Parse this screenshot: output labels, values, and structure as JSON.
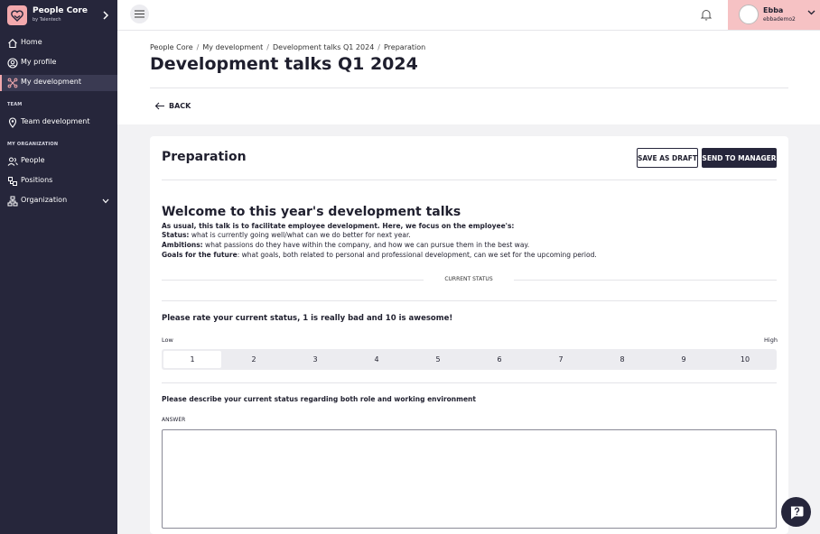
{
  "brand": {
    "title": "People Core",
    "subtitle": "by Talentech"
  },
  "sidebar": {
    "items": [
      {
        "label": "Home",
        "icon": "home-icon"
      },
      {
        "label": "My profile",
        "icon": "user-circle-icon"
      },
      {
        "label": "My development",
        "icon": "development-icon",
        "active": true
      },
      {
        "label": "Team development",
        "icon": "location-pin-icon"
      },
      {
        "label": "People",
        "icon": "people-icon"
      },
      {
        "label": "Positions",
        "icon": "positions-icon"
      },
      {
        "label": "Organization",
        "icon": "organization-icon"
      }
    ],
    "sections": [
      "TEAM",
      "MY ORGANIZATION"
    ]
  },
  "topbar": {
    "user_name": "Ebba",
    "user_handle": "ebbademo2"
  },
  "breadcrumb": [
    "People Core",
    "My development",
    "Development talks Q1 2024",
    "Preparation"
  ],
  "page_title": "Development talks Q1 2024",
  "back_label": "BACK",
  "card": {
    "title": "Preparation",
    "save_draft_label": "SAVE AS DRAFT",
    "send_label": "SEND TO MANAGER",
    "welcome_title": "Welcome to this year's development talks",
    "intro": "As usual, this talk is to facilitate employee development. Here, we focus on the employee's:",
    "status_term": "Status:",
    "status_text": " what is currently going well/what can we do better for next year.",
    "ambitions_term": "Ambitions:",
    "ambitions_text": " what passions do they have within the company, and how we can pursue them in the best way.",
    "goals_term": "Goals for the future",
    "goals_text": ": what goals, both related to personal and professional development, can we set for the upcoming period.",
    "section_label": "CURRENT STATUS",
    "question1": "Please rate your current status, 1 is really bad and 10 is awesome!",
    "low_label": "Low",
    "high_label": "High",
    "rating_options": [
      "1",
      "2",
      "3",
      "4",
      "5",
      "6",
      "7",
      "8",
      "9",
      "10"
    ],
    "rating_selected": "1",
    "question2": "Please describe your current status regarding both role and working environment",
    "answer_label": "ANSWER",
    "answer_value": ""
  },
  "colors": {
    "sidebar_bg": "#26263b",
    "accent_pink": "#f3a9ad",
    "user_bg": "#f6c2c4"
  }
}
